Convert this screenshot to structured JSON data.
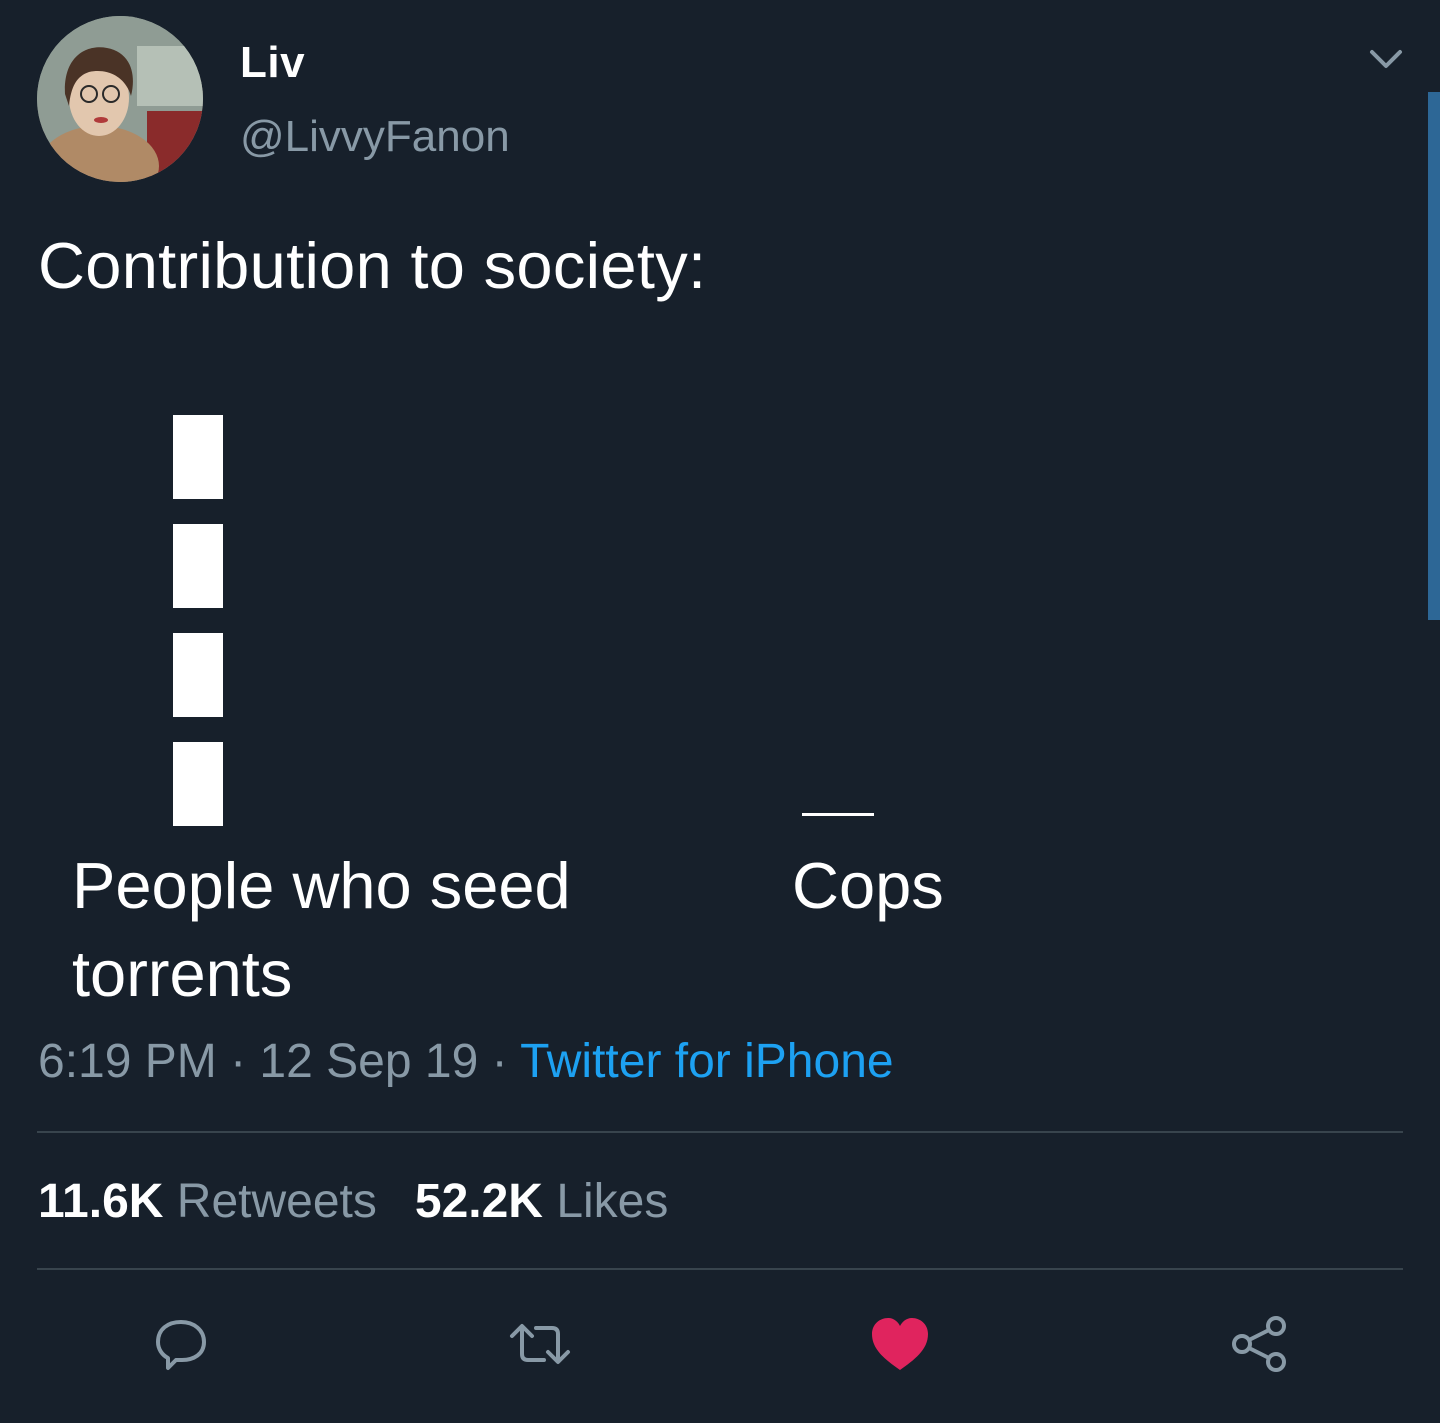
{
  "author": {
    "name": "Liv",
    "handle": "@LivvyFanon"
  },
  "tweet": {
    "text": "Contribution to society:",
    "chart_data": {
      "type": "bar",
      "categories": [
        "People who seed torrents",
        "Cops"
      ],
      "values": [
        4,
        0
      ],
      "title": "",
      "xlabel": "",
      "ylabel": ""
    },
    "labels": {
      "left": "People who seed torrents",
      "right": "Cops"
    },
    "time": "6:19 PM",
    "separator": " · ",
    "date": "12 Sep 19",
    "source": "Twitter for iPhone"
  },
  "stats": {
    "retweets_count": "11.6K",
    "retweets_label": "Retweets",
    "likes_count": "52.2K",
    "likes_label": "Likes"
  },
  "actions": {
    "reply": "reply-icon",
    "retweet": "retweet-icon",
    "like": "heart-icon",
    "share": "share-icon"
  },
  "colors": {
    "background": "#17202b",
    "muted": "#8899a6",
    "link": "#1da1f2",
    "like": "#e0245e",
    "scrollbar": "#2d6796"
  }
}
